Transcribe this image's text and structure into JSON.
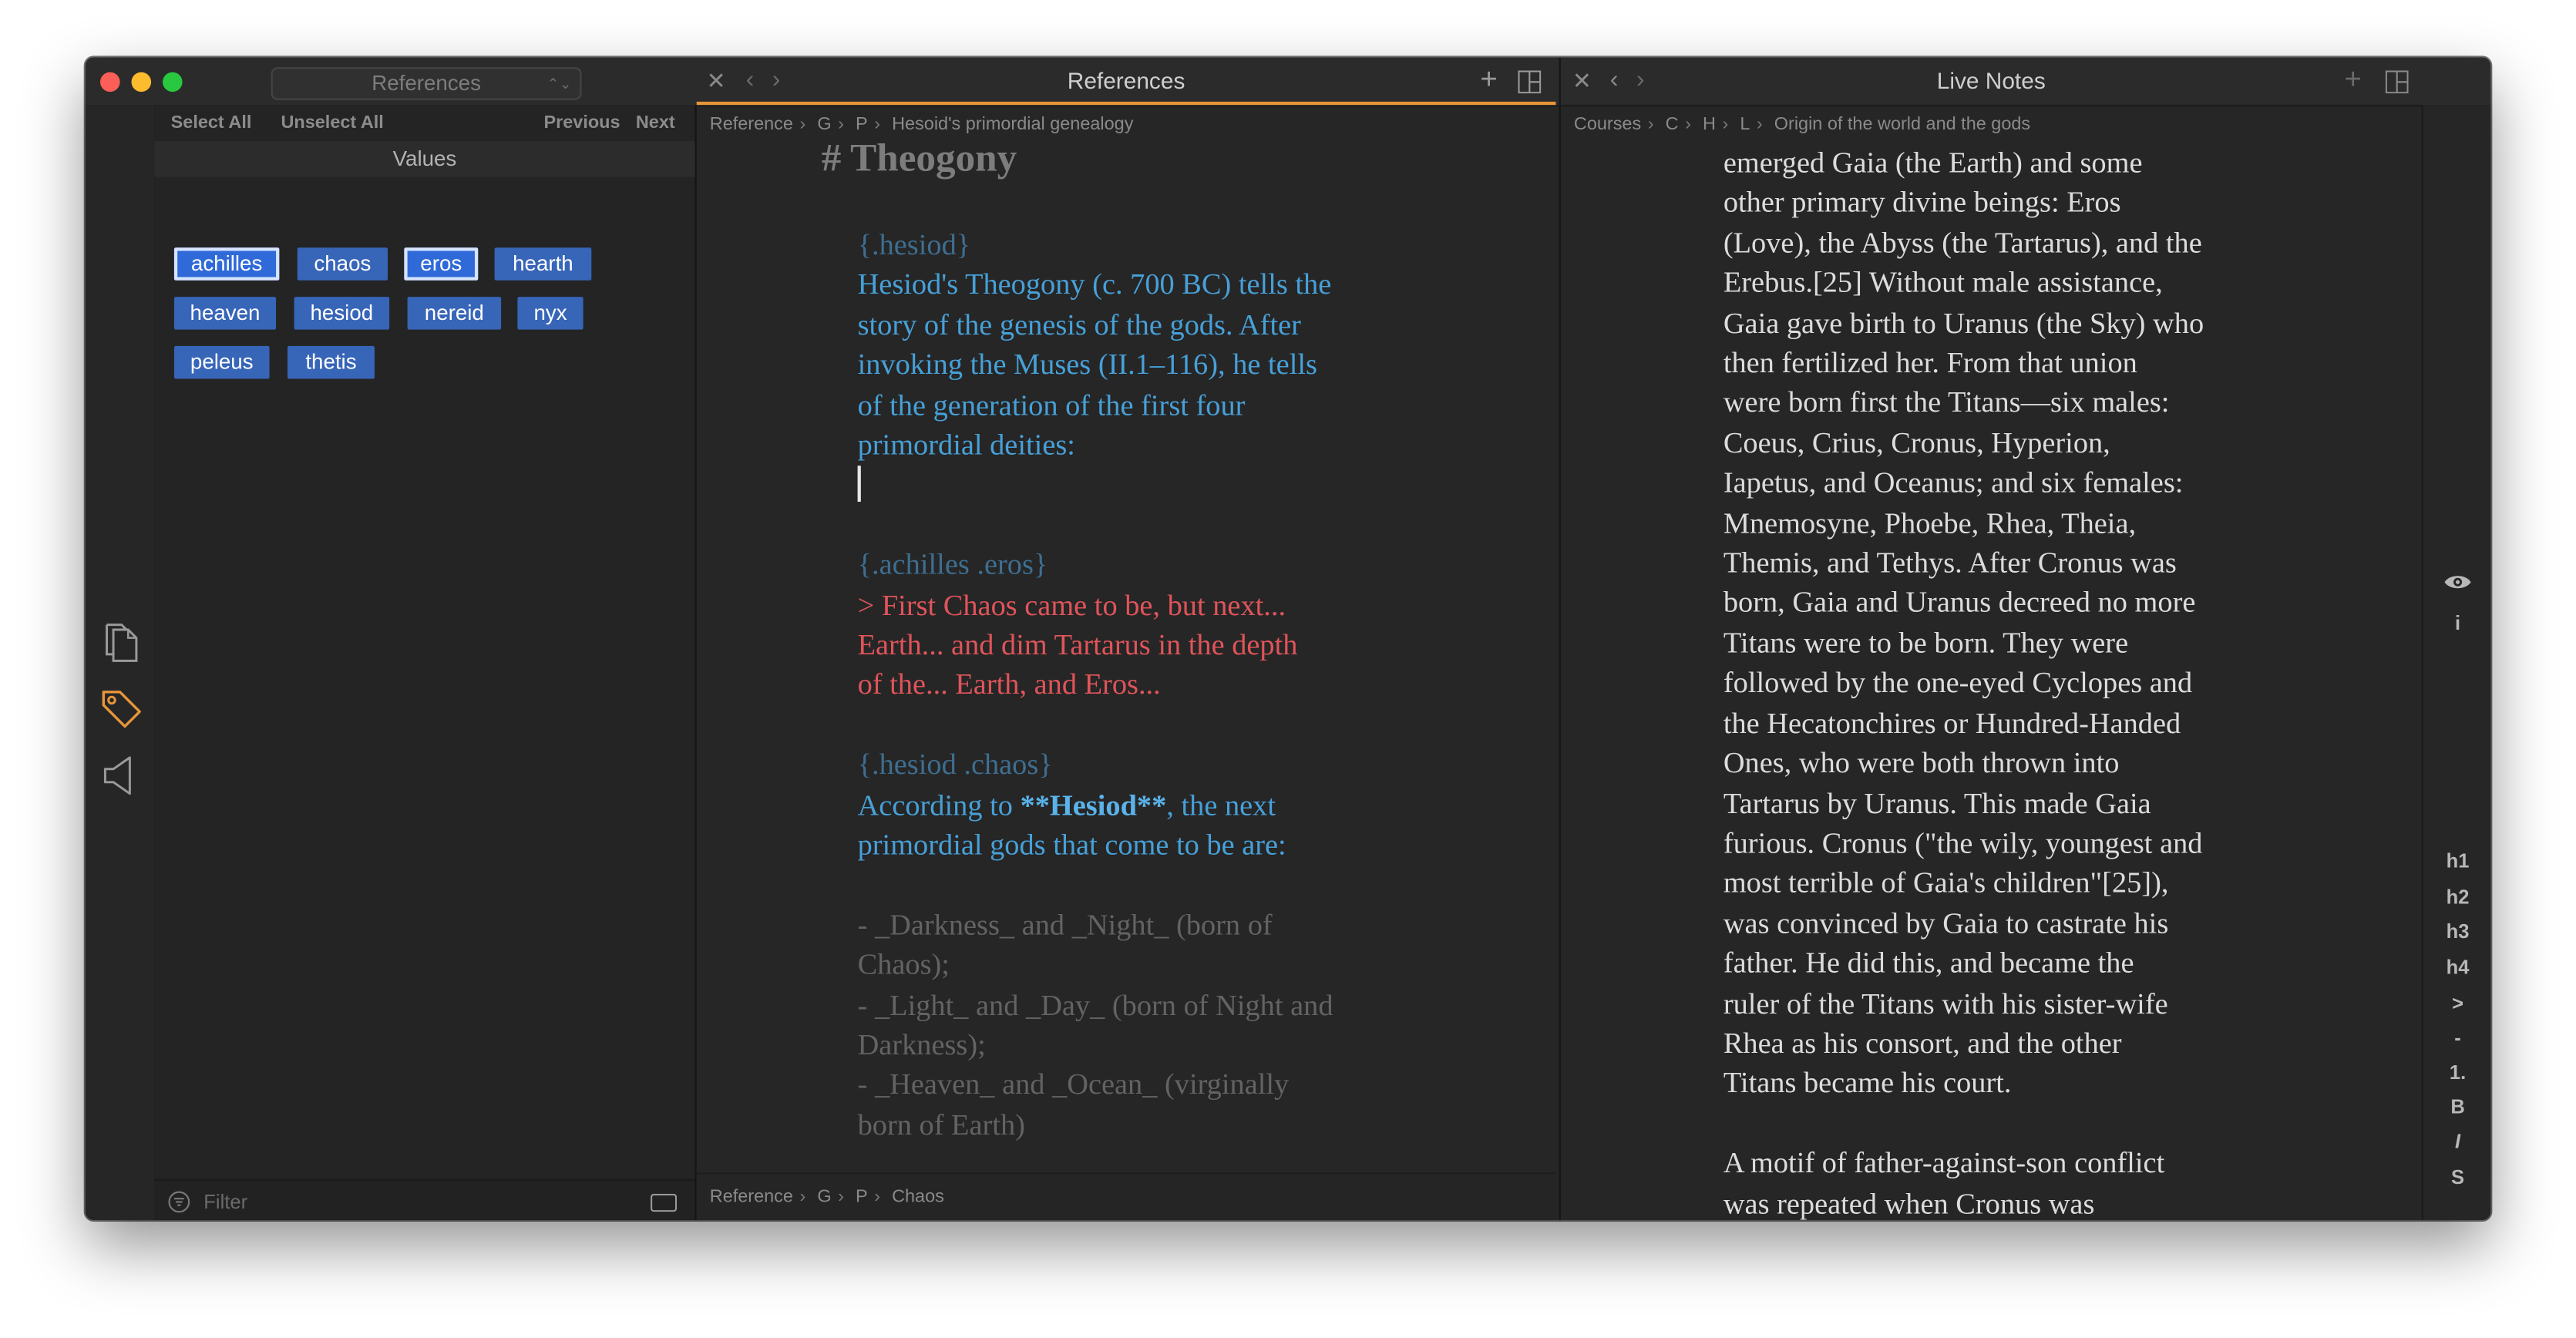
{
  "left_panel": {
    "selector_label": "References",
    "actions": {
      "select_all": "Select All",
      "unselect_all": "Unselect All",
      "previous": "Previous",
      "next": "Next"
    },
    "values_title": "Values",
    "tags": [
      {
        "label": "achilles",
        "selected": true
      },
      {
        "label": "chaos",
        "selected": false
      },
      {
        "label": "eros",
        "selected": true
      },
      {
        "label": "hearth",
        "selected": false
      },
      {
        "label": "heaven",
        "selected": false
      },
      {
        "label": "hesiod",
        "selected": false
      },
      {
        "label": "nereid",
        "selected": false
      },
      {
        "label": "nyx",
        "selected": false
      },
      {
        "label": "peleus",
        "selected": false
      },
      {
        "label": "thetis",
        "selected": false
      }
    ],
    "filter_placeholder": "Filter"
  },
  "middle_pane": {
    "title": "References",
    "breadcrumb": [
      "Reference",
      "G",
      "P",
      "Hesoid's primordial genealogy"
    ],
    "heading": "# Theogony",
    "block1_tag": "{.hesiod}",
    "block1_lines": [
      "Hesiod's Theogony (c. 700 BC) tells the",
      "story of the genesis of the gods. After",
      "invoking the Muses (II.1–116), he tells",
      "of the generation of the first four",
      "primordial deities:"
    ],
    "block2_tag": "{.achilles  .eros}",
    "block2_lines": [
      "> First Chaos came to be, but next...",
      "Earth... and dim Tartarus in the depth",
      "of the... Earth, and Eros..."
    ],
    "block3_tag": "{.hesiod .chaos}",
    "block3_line1_prefix": "According to ",
    "block3_line1_bold": "**Hesiod**",
    "block3_line1_suffix": ", the next",
    "block3_line2": "primordial gods that come to be are:",
    "list_lines": [
      "- _Darkness_ and _Night_ (born of",
      "Chaos);",
      "- _Light_ and _Day_ (born of Night and",
      "Darkness);",
      "- _Heaven_ and _Ocean_ (virginally",
      "born of Earth)"
    ],
    "bottom_breadcrumb": [
      "Reference",
      "G",
      "P",
      "Chaos"
    ]
  },
  "right_pane": {
    "title": "Live Notes",
    "breadcrumb": [
      "Courses",
      "C",
      "H",
      "L",
      "Origin of the world and the gods"
    ],
    "paragraph1": [
      "emerged Gaia (the Earth) and some",
      "other primary divine beings: Eros",
      "(Love), the Abyss (the Tartarus), and the",
      "Erebus.[25] Without male assistance,",
      "Gaia gave birth to Uranus (the Sky) who",
      "then fertilized her. From that union",
      "were born first the Titans—six males:",
      "Coeus, Crius, Cronus, Hyperion,",
      "Iapetus, and Oceanus; and six females:",
      "Mnemosyne, Phoebe, Rhea, Theia,",
      "Themis, and Tethys. After Cronus was",
      "born, Gaia and Uranus decreed no more",
      "Titans were to be born. They were",
      "followed by the one-eyed Cyclopes and",
      "the Hecatonchires or Hundred-Handed",
      "Ones, who were both thrown into",
      "Tartarus by Uranus. This made Gaia",
      "furious. Cronus (\"the wily, youngest and",
      "most terrible of Gaia's children\"[25]),",
      "was convinced by Gaia to castrate his",
      "father. He did this, and became the",
      "ruler of the Titans with his sister-wife",
      "Rhea as his consort, and the other",
      "Titans became his court."
    ],
    "paragraph2": [
      "A motif of father-against-son conflict",
      "was repeated when Cronus was"
    ]
  },
  "format_bar": {
    "info": "i",
    "items": [
      "h1",
      "h2",
      "h3",
      "h4",
      ">",
      "-",
      "1.",
      "B",
      "I",
      "S"
    ]
  },
  "icons": {
    "documents": "documents-icon",
    "tag": "tag-icon",
    "speaker": "speaker-icon",
    "eye": "eye-icon"
  },
  "colors": {
    "accent_orange": "#e8953a",
    "tag_blue": "#3765b8",
    "text_blue": "#47a0d8",
    "text_red": "#e0545a"
  }
}
